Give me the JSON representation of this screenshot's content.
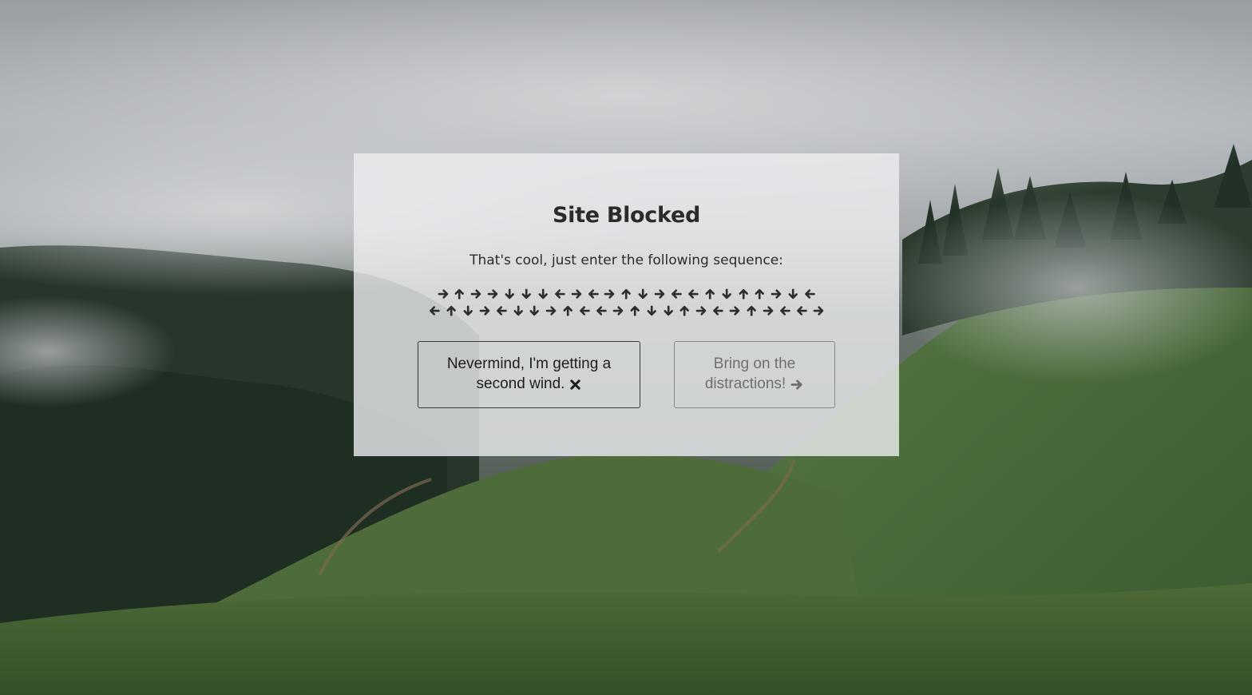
{
  "colors": {
    "modal_background": "#eceef0",
    "text_dark": "#2b2b2b",
    "arrow": "#2e2e2e",
    "button_primary_border": "#3a3a3a",
    "button_secondary_text": "#6f6f6f"
  },
  "modal": {
    "title": "Site Blocked",
    "subtitle": "That's cool, just enter the following sequence:",
    "sequence": [
      [
        "right",
        "up",
        "right",
        "right",
        "down",
        "down",
        "down",
        "left",
        "right",
        "left",
        "right",
        "up",
        "down",
        "right",
        "left",
        "left",
        "up",
        "down",
        "up",
        "up",
        "right",
        "down",
        "left"
      ],
      [
        "left",
        "up",
        "down",
        "right",
        "left",
        "down",
        "down",
        "right",
        "up",
        "left",
        "left",
        "right",
        "up",
        "down",
        "down",
        "up",
        "right",
        "left",
        "right",
        "up",
        "right",
        "left",
        "left",
        "right"
      ]
    ],
    "buttons": {
      "stay": {
        "label": "Nevermind, I'm getting a second wind.",
        "icon": "close-icon"
      },
      "go": {
        "label": "Bring on the distractions!",
        "icon": "arrow-right-icon"
      }
    }
  }
}
